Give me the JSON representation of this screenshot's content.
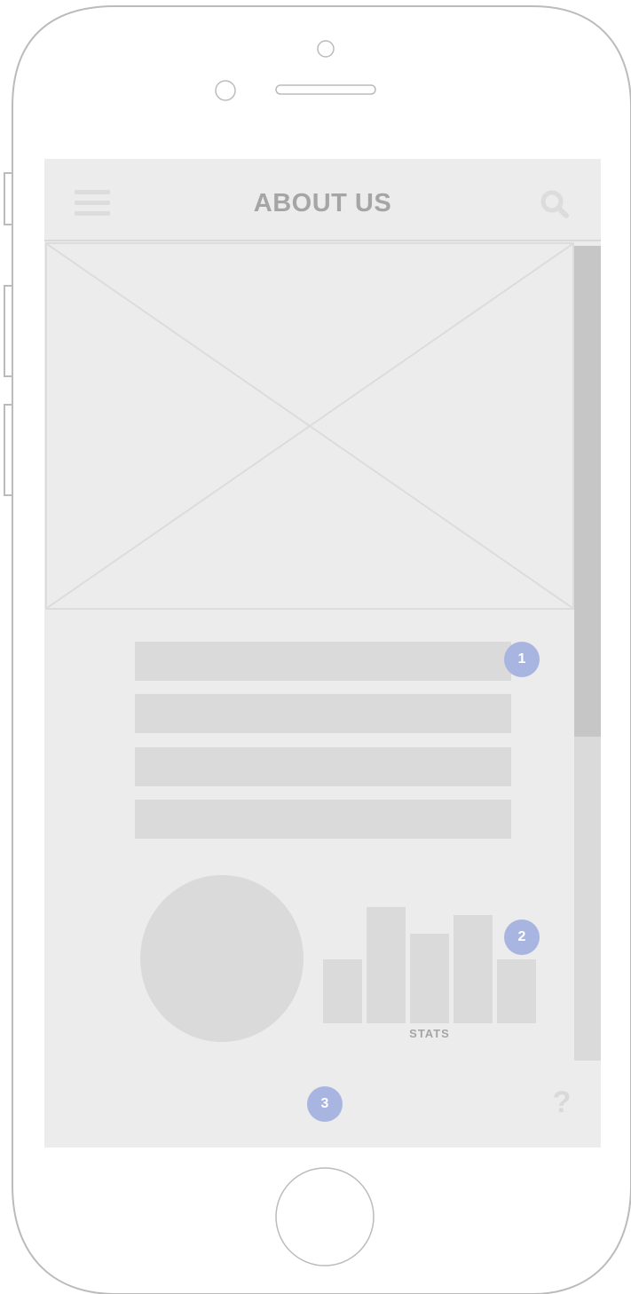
{
  "header": {
    "title": "ABOUT US",
    "menu_icon": "hamburger-menu-icon",
    "search_icon": "search-icon"
  },
  "hero_image": {
    "placeholder": "image-placeholder"
  },
  "content": {
    "marker_text": "1",
    "text_lines": 4
  },
  "stats": {
    "marker_text": "2",
    "label": "STATS"
  },
  "footer": {
    "marker_text": "3",
    "help_icon": "?"
  },
  "colors": {
    "screen_bg": "#ececec",
    "placeholder": "#dadada",
    "marker": "#a8b5e0",
    "title_text": "#a5a5a5",
    "scroll_thumb": "#c6c6c6"
  },
  "scroll": {
    "thumb_fraction": 0.6
  },
  "chart_data": {
    "type": "bar",
    "categories": [
      "",
      "",
      "",
      "",
      ""
    ],
    "values": [
      72,
      131,
      101,
      122,
      72
    ],
    "title": "",
    "xlabel": "STATS",
    "ylabel": "",
    "ylim": [
      0,
      140
    ]
  }
}
